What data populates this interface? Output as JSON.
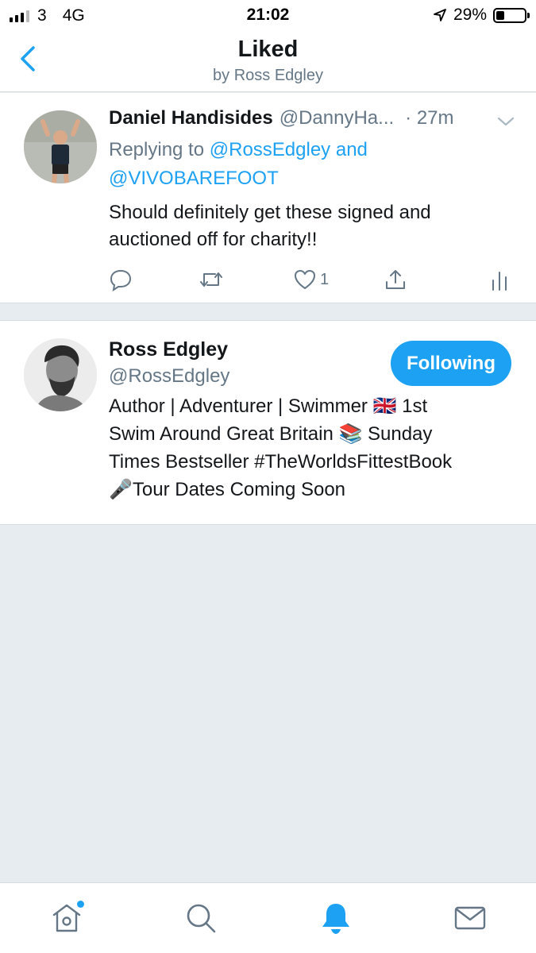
{
  "status_bar": {
    "carrier": "3",
    "network": "4G",
    "time": "21:02",
    "battery": "29%",
    "battery_level": 0.29
  },
  "header": {
    "title": "Liked",
    "subtitle": "by Ross Edgley"
  },
  "tweet": {
    "author_name": "Daniel Handisides",
    "author_handle": "@DannyHa...",
    "time": "27m",
    "replying_prefix": "Replying to",
    "mention_1": "@RossEdgley",
    "and_word": "and",
    "mention_2": "@VIVOBAREFOOT",
    "text": "Should definitely get these signed and auctioned off for charity!!",
    "like_count": "1"
  },
  "user_card": {
    "name": "Ross Edgley",
    "handle": "@RossEdgley",
    "follow_label": "Following",
    "bio_line_1": "Author | Adventurer | Swimmer 🇬🇧 1st",
    "bio_line_2": "Swim Around Great Britain 📚 Sunday",
    "bio_line_3": "Times Bestseller #TheWorldsFittestBook",
    "bio_line_4": "🎤Tour Dates Coming Soon"
  },
  "tabs": [
    {
      "icon": "home-icon",
      "active": false,
      "notification_dot": true
    },
    {
      "icon": "search-icon",
      "active": false
    },
    {
      "icon": "bell-icon",
      "active": true
    },
    {
      "icon": "mail-icon",
      "active": false
    }
  ],
  "colors": {
    "accent": "#1da1f2",
    "muted": "#657786",
    "background": "#e6ecf0"
  }
}
